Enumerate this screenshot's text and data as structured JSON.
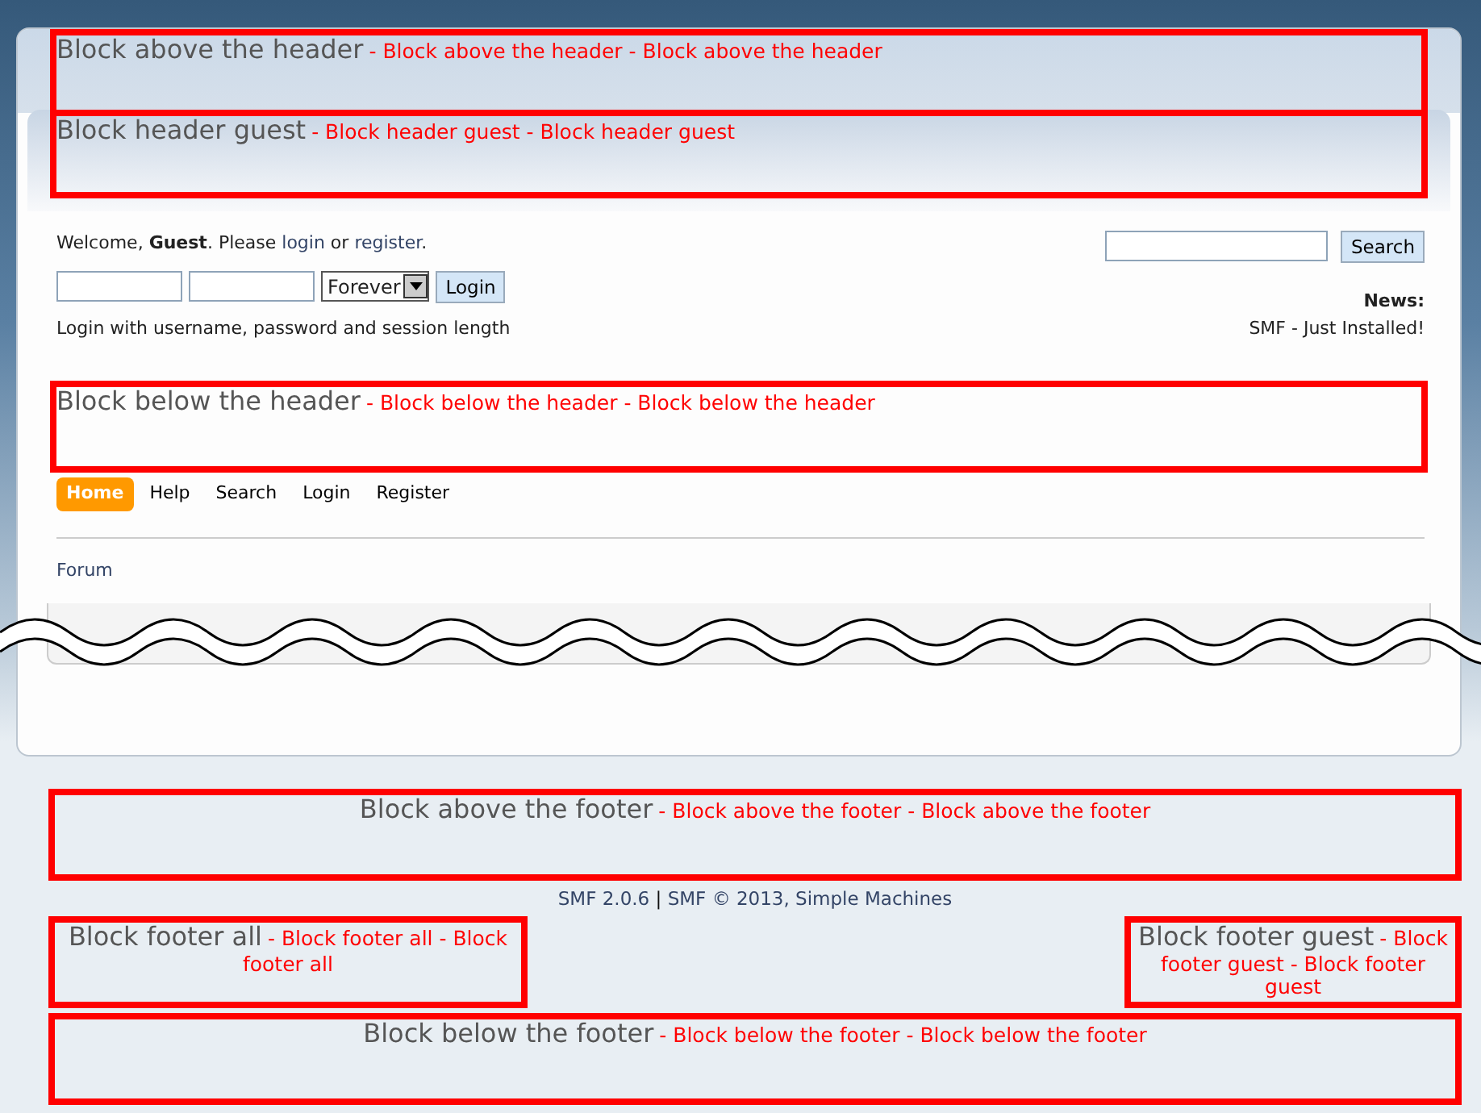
{
  "block_above_header": {
    "title": "Block above the header",
    "text": "- Block above the header - Block above the header"
  },
  "block_header_guest": {
    "title": "Block header guest",
    "text": "- Block header guest - Block header guest"
  },
  "welcome": [
    {
      "kind": "text",
      "text": "Welcome, **Guest**. Please "
    },
    {
      "kind": "link",
      "text": "login"
    },
    {
      "kind": "text",
      "text": " or "
    },
    {
      "kind": "link",
      "text": "register"
    },
    {
      "kind": "text",
      "text": "."
    }
  ],
  "login_form": {
    "session": "Forever",
    "button": "Login",
    "hint": "Login with username, password and session length"
  },
  "search": {
    "button": "Search"
  },
  "news": {
    "label": "News:",
    "text": "SMF - Just Installed!"
  },
  "block_below_header": {
    "title": "Block below the header",
    "text": "- Block below the header - Block below the header"
  },
  "menu": [
    {
      "label": "Home",
      "selected": true
    },
    {
      "label": "Help",
      "selected": false
    },
    {
      "label": "Search",
      "selected": false
    },
    {
      "label": "Login",
      "selected": false
    },
    {
      "label": "Register",
      "selected": false
    }
  ],
  "linktree": "Forum",
  "block_above_footer": {
    "title": "Block above the footer",
    "text": "- Block above the footer - Block above the footer"
  },
  "copyright": [
    {
      "kind": "link",
      "text": "SMF 2.0.6"
    },
    {
      "kind": "text",
      "text": " | "
    },
    {
      "kind": "link",
      "text": "SMF © 2013, Simple Machines"
    }
  ],
  "block_footer_all": {
    "title": "Block footer all",
    "text": "- Block footer all - Block footer all"
  },
  "block_footer_guest": {
    "title": "Block footer guest",
    "text": "- Block footer guest - Block footer guest"
  },
  "block_below_footer": {
    "title": "Block below the footer",
    "text": "- Block below the footer - Block below the footer"
  }
}
